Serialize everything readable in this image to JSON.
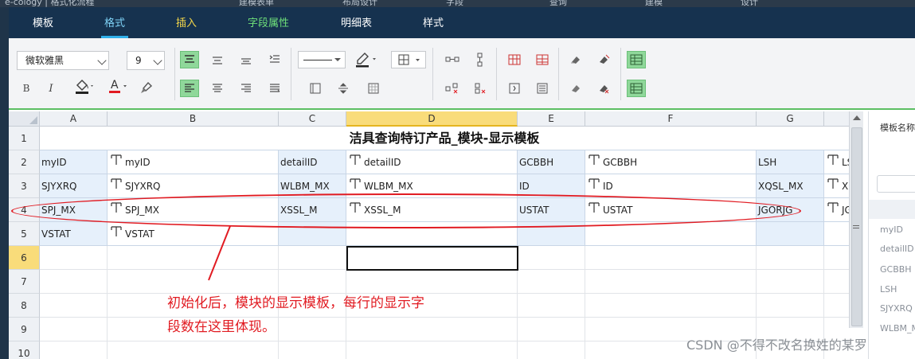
{
  "browser_tabs": [
    "e-cology | 格式化流程",
    "建模表单",
    "布局设计",
    "字段",
    "查询",
    "建模",
    "设计"
  ],
  "menu": {
    "items": [
      {
        "label": "模板",
        "color": "white"
      },
      {
        "label": "格式",
        "color": "active"
      },
      {
        "label": "插入",
        "color": "yellow"
      },
      {
        "label": "字段属性",
        "color": "green"
      },
      {
        "label": "明细表",
        "color": "white"
      },
      {
        "label": "样式",
        "color": "white"
      }
    ]
  },
  "toolbar": {
    "font_family": "微软雅黑",
    "font_size": "9",
    "bold": "B",
    "italic": "I",
    "font_color_label": "A",
    "accent_green": "#8fd89a"
  },
  "sheet": {
    "columns": [
      "A",
      "B",
      "C",
      "D",
      "E",
      "F",
      "G"
    ],
    "selected_column": "D",
    "selected_row": "6",
    "rows": [
      "1",
      "2",
      "3",
      "4",
      "5",
      "6",
      "7",
      "8",
      "9",
      "10"
    ],
    "title": "洁具查询特订产品_模块-显示模板",
    "data": [
      [
        "myID",
        "myID",
        "detailID",
        "detailID",
        "GCBBH",
        "GCBBH",
        "LSH",
        "LSH"
      ],
      [
        "SJYXRQ",
        "SJYXRQ",
        "WLBM_MX",
        "WLBM_MX",
        "ID",
        "ID",
        "XQSL_MX",
        "XQSL_MX"
      ],
      [
        "SPJ_MX",
        "SPJ_MX",
        "XSSL_M",
        "XSSL_M",
        "USTAT",
        "USTAT",
        "JGORJG",
        "JGORJG"
      ],
      [
        "VSTAT",
        "VSTAT",
        "",
        "",
        "",
        "",
        "",
        ""
      ]
    ]
  },
  "right_panel": {
    "title": "模板名称",
    "fields": [
      "myID",
      "detailID",
      "GCBBH",
      "LSH",
      "SJYXRQ",
      "WLBM_MX"
    ]
  },
  "annotation": {
    "line1": "初始化后，模块的显示模板，每行的显示字",
    "line2": "段数在这里体现。",
    "color": "#e11b22"
  },
  "watermark": "CSDN @不得不改名换姓的某罗"
}
